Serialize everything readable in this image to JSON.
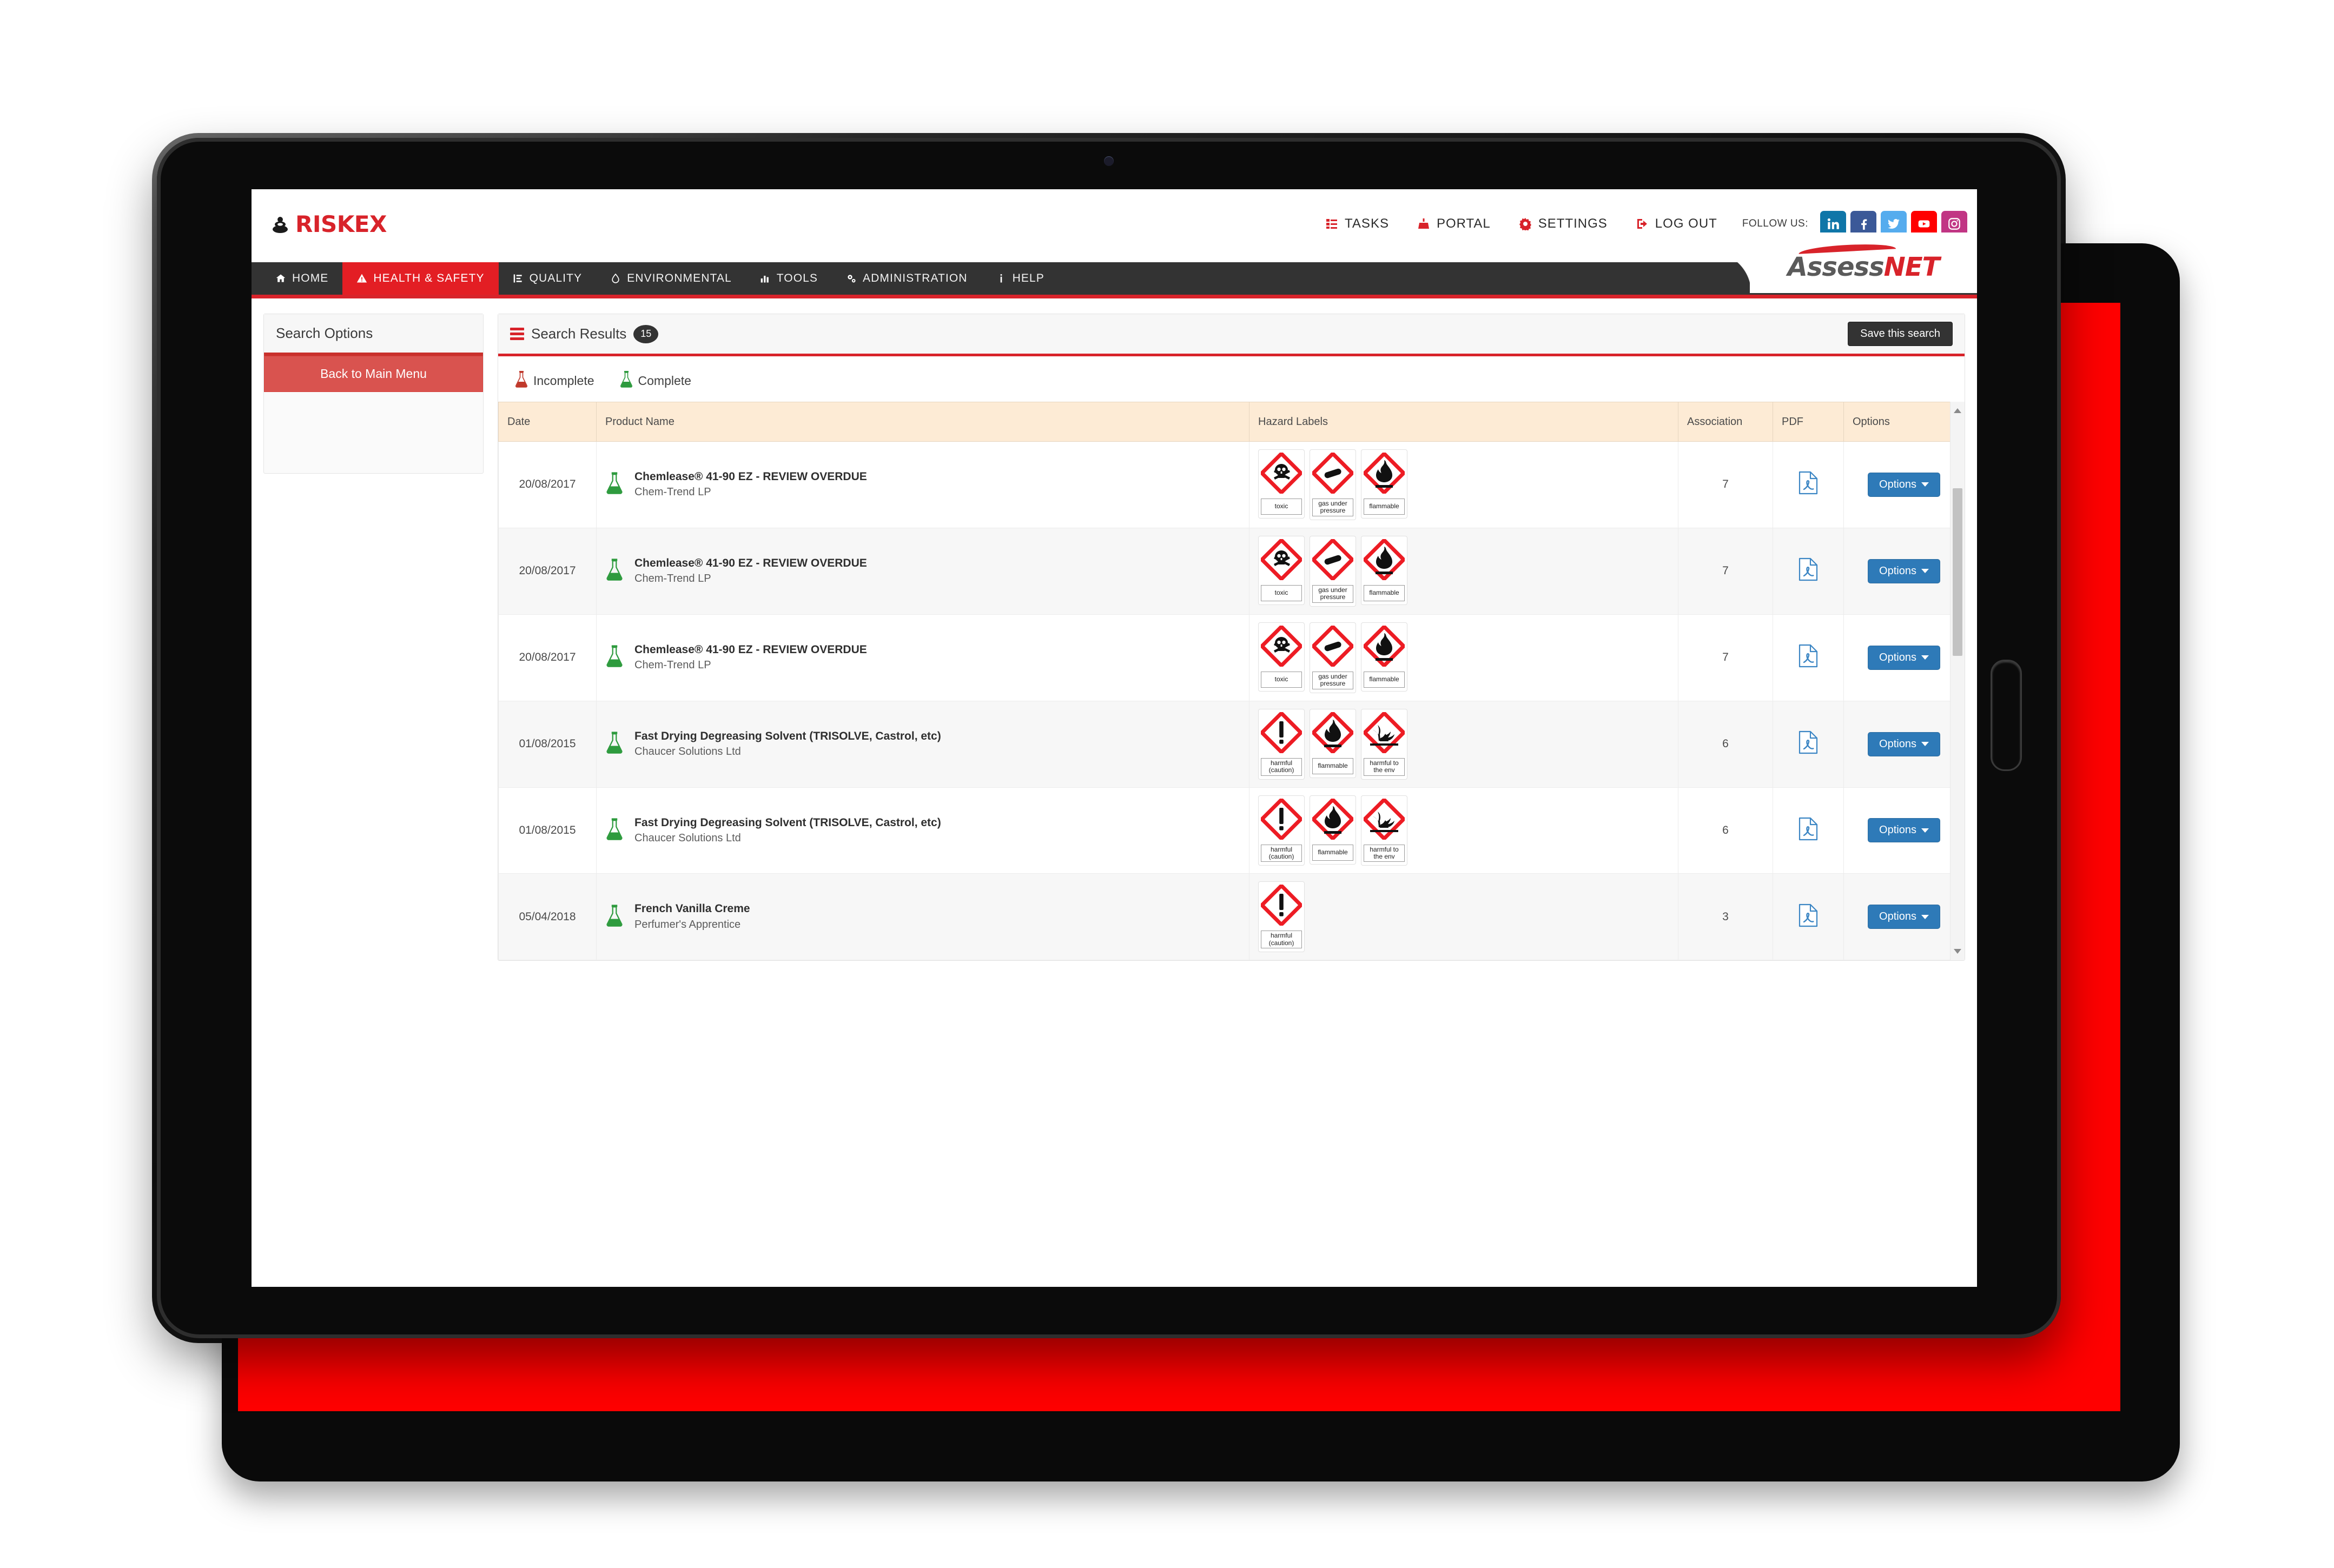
{
  "brand": {
    "name": "RISKEX",
    "logo_color": "#d8232a"
  },
  "product_logo": {
    "part1": "Assess",
    "part2": "NET"
  },
  "topnav": {
    "items": [
      {
        "label": "TASKS",
        "icon": "tasks-icon"
      },
      {
        "label": "PORTAL",
        "icon": "portal-icon"
      },
      {
        "label": "SETTINGS",
        "icon": "gear-icon"
      },
      {
        "label": "LOG OUT",
        "icon": "logout-icon"
      }
    ],
    "follow_label": "FOLLOW US:",
    "social": [
      {
        "name": "linkedin",
        "glyph": "in",
        "color": "#0f76a8"
      },
      {
        "name": "facebook",
        "glyph": "f",
        "color": "#3b5998"
      },
      {
        "name": "twitter",
        "glyph": "",
        "color": "#55acee"
      },
      {
        "name": "youtube",
        "glyph": "",
        "color": "#ff0000"
      },
      {
        "name": "instagram",
        "glyph": "",
        "color": "#c13584"
      }
    ]
  },
  "menubar": {
    "active": "HEALTH & SAFETY",
    "items": [
      {
        "label": "HOME",
        "icon": "home-icon"
      },
      {
        "label": "HEALTH & SAFETY",
        "icon": "warning-triangle-icon"
      },
      {
        "label": "QUALITY",
        "icon": "quality-icon"
      },
      {
        "label": "ENVIRONMENTAL",
        "icon": "droplet-icon"
      },
      {
        "label": "TOOLS",
        "icon": "bar-chart-icon"
      },
      {
        "label": "ADMINISTRATION",
        "icon": "gears-icon"
      },
      {
        "label": "HELP",
        "icon": "info-icon"
      }
    ]
  },
  "sidebar": {
    "title": "Search Options",
    "back_button": "Back to Main Menu"
  },
  "results": {
    "title": "Search Results",
    "count": "15",
    "save_button": "Save this search",
    "legend": [
      {
        "label": "Incomplete",
        "color": "#c0392b"
      },
      {
        "label": "Complete",
        "color": "#2e9b3e"
      }
    ],
    "columns": [
      "Date",
      "Product Name",
      "Hazard Labels",
      "Association",
      "PDF",
      "Options"
    ],
    "option_button_label": "Options",
    "rows": [
      {
        "date": "20/08/2017",
        "status": "complete",
        "product": "Chemlease® 41-90 EZ - REVIEW OVERDUE",
        "supplier": "Chem-Trend LP",
        "hazards": [
          {
            "icon": "ghs-skull-crossbones",
            "label": "toxic"
          },
          {
            "icon": "ghs-gas-cylinder",
            "label": "gas under pressure"
          },
          {
            "icon": "ghs-flame",
            "label": "flammable"
          }
        ],
        "association": "7"
      },
      {
        "date": "20/08/2017",
        "status": "complete",
        "product": "Chemlease® 41-90 EZ - REVIEW OVERDUE",
        "supplier": "Chem-Trend LP",
        "hazards": [
          {
            "icon": "ghs-skull-crossbones",
            "label": "toxic"
          },
          {
            "icon": "ghs-gas-cylinder",
            "label": "gas under pressure"
          },
          {
            "icon": "ghs-flame",
            "label": "flammable"
          }
        ],
        "association": "7"
      },
      {
        "date": "20/08/2017",
        "status": "complete",
        "product": "Chemlease® 41-90 EZ - REVIEW OVERDUE",
        "supplier": "Chem-Trend LP",
        "hazards": [
          {
            "icon": "ghs-skull-crossbones",
            "label": "toxic"
          },
          {
            "icon": "ghs-gas-cylinder",
            "label": "gas under pressure"
          },
          {
            "icon": "ghs-flame",
            "label": "flammable"
          }
        ],
        "association": "7"
      },
      {
        "date": "01/08/2015",
        "status": "complete",
        "product": "Fast Drying Degreasing Solvent (TRISOLVE, Castrol, etc)",
        "supplier": "Chaucer Solutions Ltd",
        "hazards": [
          {
            "icon": "ghs-exclamation",
            "label": "harmful (caution)"
          },
          {
            "icon": "ghs-flame",
            "label": "flammable"
          },
          {
            "icon": "ghs-environment",
            "label": "harmful to the env"
          }
        ],
        "association": "6"
      },
      {
        "date": "01/08/2015",
        "status": "complete",
        "product": "Fast Drying Degreasing Solvent (TRISOLVE, Castrol, etc)",
        "supplier": "Chaucer Solutions Ltd",
        "hazards": [
          {
            "icon": "ghs-exclamation",
            "label": "harmful (caution)"
          },
          {
            "icon": "ghs-flame",
            "label": "flammable"
          },
          {
            "icon": "ghs-environment",
            "label": "harmful to the env"
          }
        ],
        "association": "6"
      },
      {
        "date": "05/04/2018",
        "status": "complete",
        "product": "French Vanilla Creme",
        "supplier": "Perfumer's Apprentice",
        "hazards": [
          {
            "icon": "ghs-exclamation",
            "label": "harmful (caution)"
          }
        ],
        "association": "3"
      }
    ]
  }
}
